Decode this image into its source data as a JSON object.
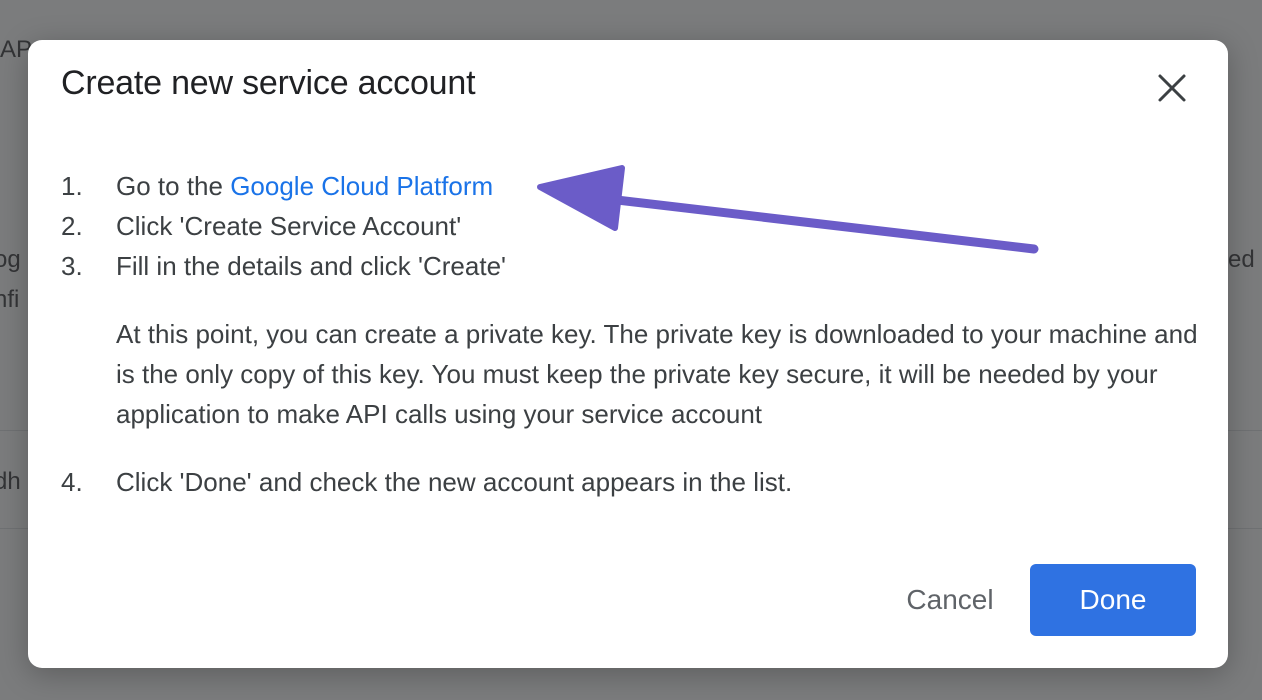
{
  "background_page": {
    "fragments": [
      "AP",
      "og",
      "nfi",
      "dh",
      "ed"
    ]
  },
  "dialog": {
    "title": "Create new service account",
    "steps": [
      {
        "number": "1.",
        "text_prefix": "Go to the ",
        "link": "Google Cloud Platform"
      },
      {
        "number": "2.",
        "text": "Click 'Create Service Account'"
      },
      {
        "number": "3.",
        "text": "Fill in the details and click 'Create'"
      },
      {
        "number": "4.",
        "text": "Click 'Done' and check the new account appears in the list."
      }
    ],
    "note": "At this point, you can create a private key. The private key is downloaded to your machine and is the only copy of this key. You must keep the private key secure, it will be needed by your application to make API calls using your service account",
    "actions": {
      "cancel_label": "Cancel",
      "done_label": "Done"
    }
  },
  "colors": {
    "link": "#1a73e8",
    "primary_button": "#2f72e2",
    "annotation_arrow": "#6b5cc8"
  },
  "icons": {
    "close": "close-icon",
    "annotation": "annotation-arrow"
  }
}
